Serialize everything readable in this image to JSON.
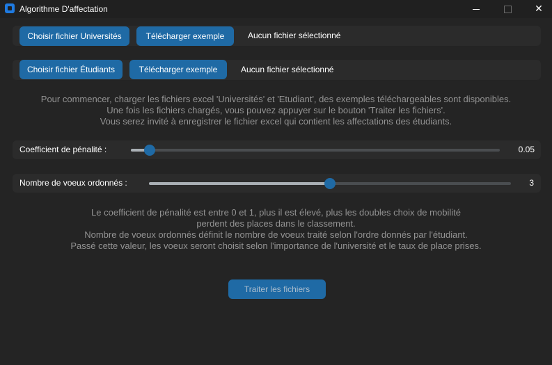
{
  "window": {
    "title": "Algorithme D'affectation",
    "icon": "app-icon",
    "controls": [
      "minimize-icon",
      "maximize-icon",
      "close-icon"
    ]
  },
  "universities": {
    "choose_label": "Choisir fichier Universités",
    "download_label": "Télécharger exemple",
    "status": "Aucun fichier sélectionné"
  },
  "students": {
    "choose_label": "Choisir fichier Étudiants",
    "download_label": "Télécharger exemple",
    "status": "Aucun fichier sélectionné"
  },
  "intro": {
    "line1": "Pour commencer, charger les fichiers excel 'Universités' et 'Etudiant', des exemples téléchargeables sont disponibles.",
    "line2": "Une fois les fichiers chargés, vous pouvez appuyer sur le bouton 'Traiter les fichiers'.",
    "line3": "Vous serez invité à enregistrer le fichier excel qui contient les affectations des étudiants."
  },
  "penalty": {
    "label": "Coefficient de pénalité :",
    "value": "0.05",
    "fraction": 0.05
  },
  "wishes": {
    "label": "Nombre de voeux ordonnés :",
    "value": "3",
    "fraction": 0.5
  },
  "explanation": {
    "line1": "Le coefficient de pénalité est entre 0 et 1, plus il est élevé, plus les doubles choix de mobilité",
    "line2": "perdent des places dans le classement.",
    "line3": "Nombre de voeux ordonnés définit le nombre de voeux traité selon l'ordre donnés par l'étudiant.",
    "line4": "Passé cette valeur, les voeux seront choisit selon l'importance de l'université et le taux de place prises."
  },
  "process_button": "Traiter les fichiers",
  "colors": {
    "background": "#242424",
    "frame": "#2b2b2b",
    "accent": "#1f6aa5",
    "muted_text": "#939393"
  }
}
